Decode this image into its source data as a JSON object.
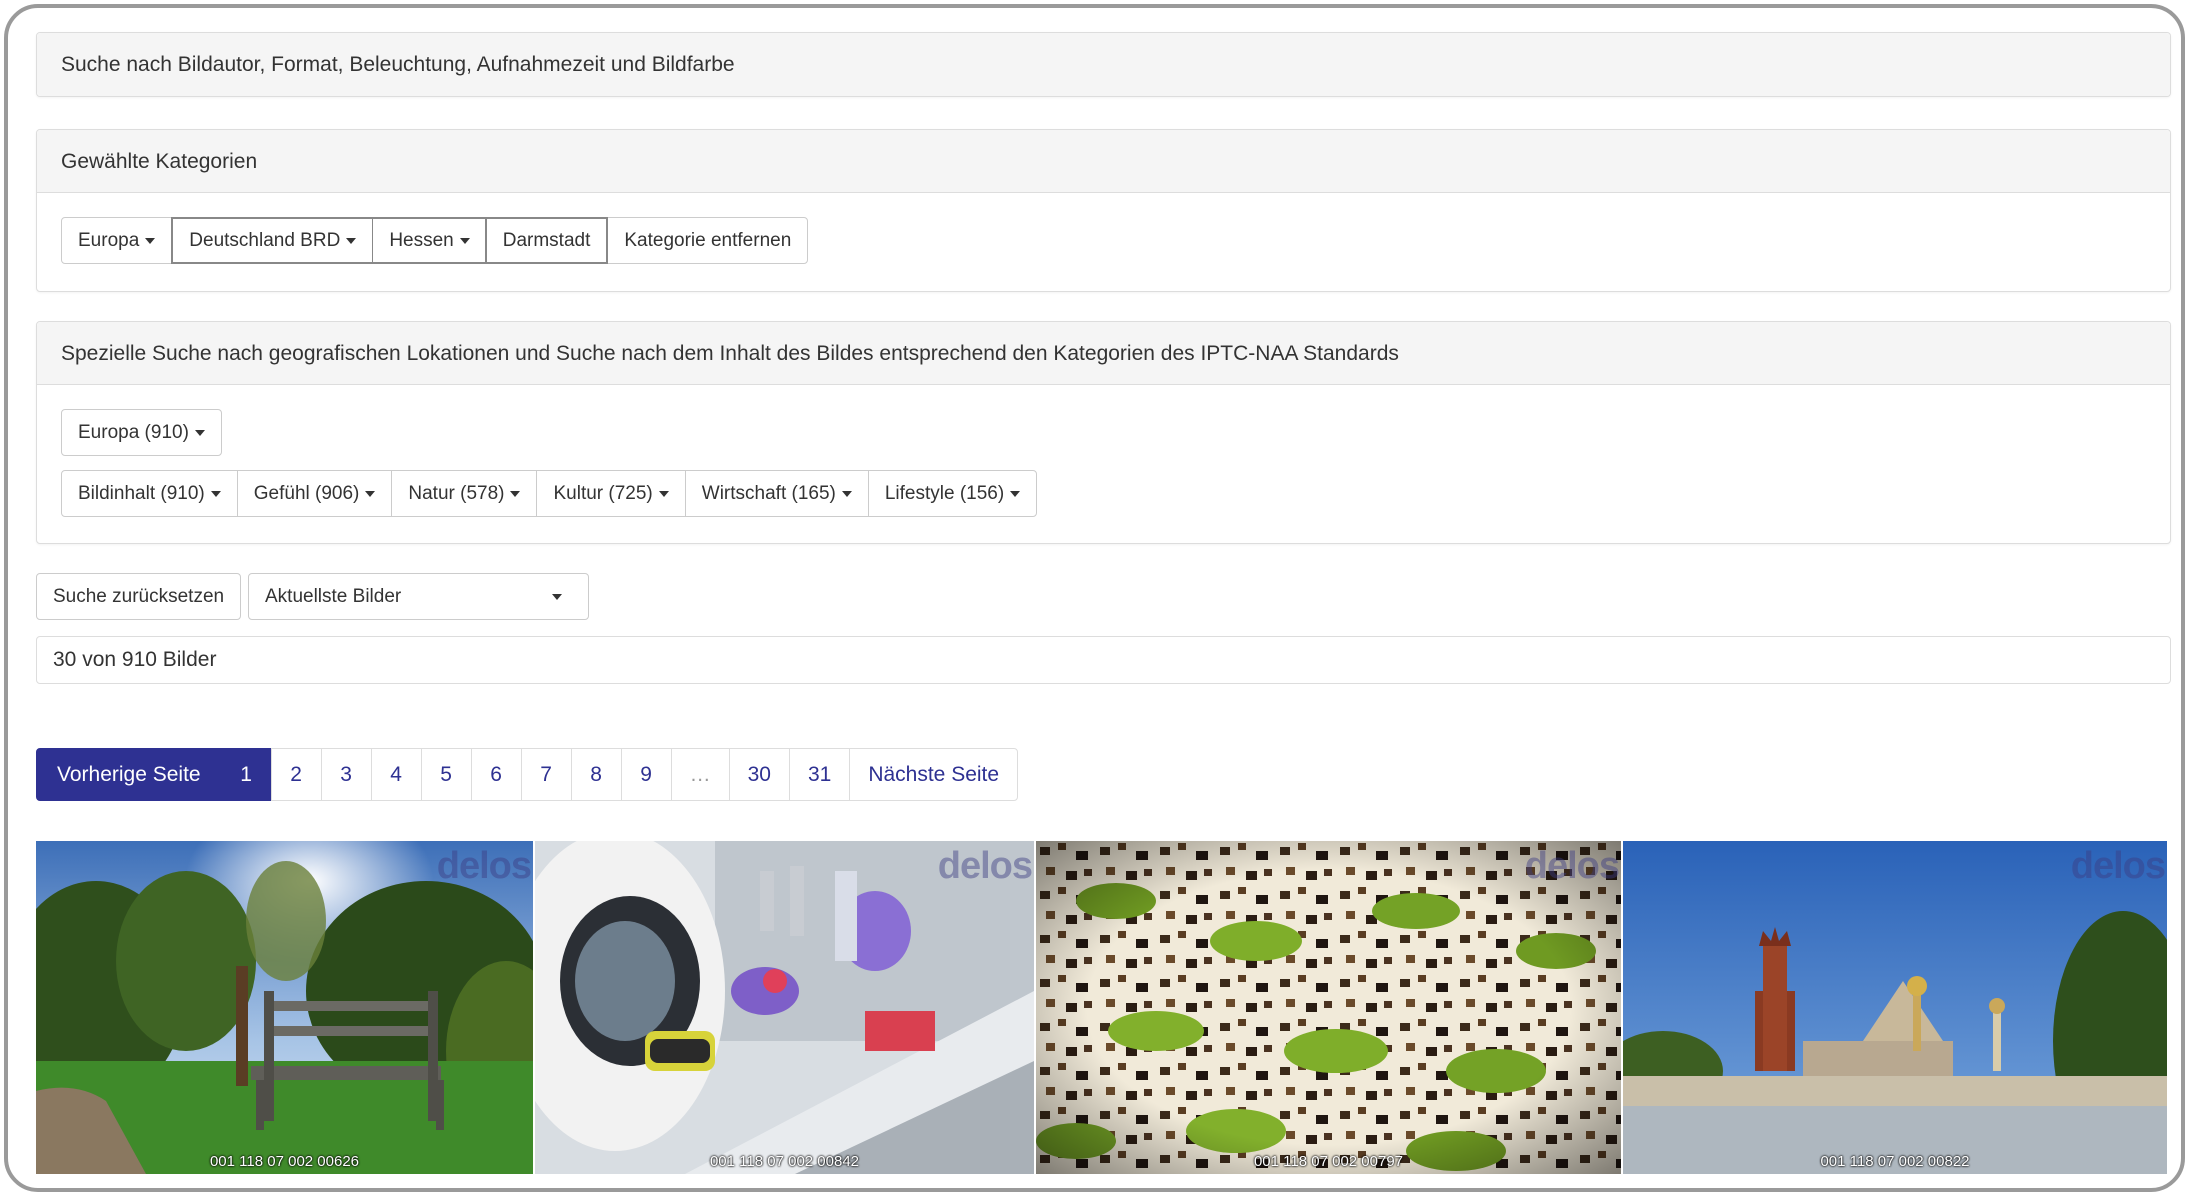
{
  "panels": {
    "advanced_search_title": "Suche nach Bildautor, Format, Beleuchtung, Aufnahmezeit und Bildfarbe",
    "selected_categories_title": "Gewählte Kategorien",
    "special_search_title": "Spezielle Suche nach geografischen Lokationen und Suche nach dem Inhalt des Bildes entsprechend den Kategorien des IPTC-NAA Standards"
  },
  "breadcrumb": {
    "items": [
      "Europa",
      "Deutschland BRD",
      "Hessen",
      "Darmstadt"
    ],
    "remove_label": "Kategorie entfernen"
  },
  "geo_filter": {
    "label": "Europa (910)"
  },
  "category_filters": [
    "Bildinhalt (910)",
    "Gefühl (906)",
    "Natur (578)",
    "Kultur (725)",
    "Wirtschaft (165)",
    "Lifestyle (156)"
  ],
  "controls": {
    "reset_label": "Suche zurücksetzen",
    "sort_selected": "Aktuellste Bilder"
  },
  "results": {
    "count_text": "30 von 910 Bilder"
  },
  "pagination": {
    "prev_label": "Vorherige Seite",
    "pages": [
      "1",
      "2",
      "3",
      "4",
      "5",
      "6",
      "7",
      "8",
      "9",
      "…",
      "30",
      "31"
    ],
    "current": "1",
    "next_label": "Nächste Seite"
  },
  "thumbnails": [
    {
      "caption": "001 118 07 002 00626",
      "watermark": "delos",
      "subject": "park-bench"
    },
    {
      "caption": "001 118 07 002 00842",
      "watermark": "delos",
      "subject": "laboratory"
    },
    {
      "caption": "001 118 07 002 00797",
      "watermark": "delos",
      "subject": "kiwi-cake"
    },
    {
      "caption": "001 118 07 002 00822",
      "watermark": "delos",
      "subject": "darmstadt-wedding-tower"
    }
  ],
  "colors": {
    "accent": "#2e3192",
    "border": "#dddddd",
    "heading_bg": "#f5f5f5"
  }
}
